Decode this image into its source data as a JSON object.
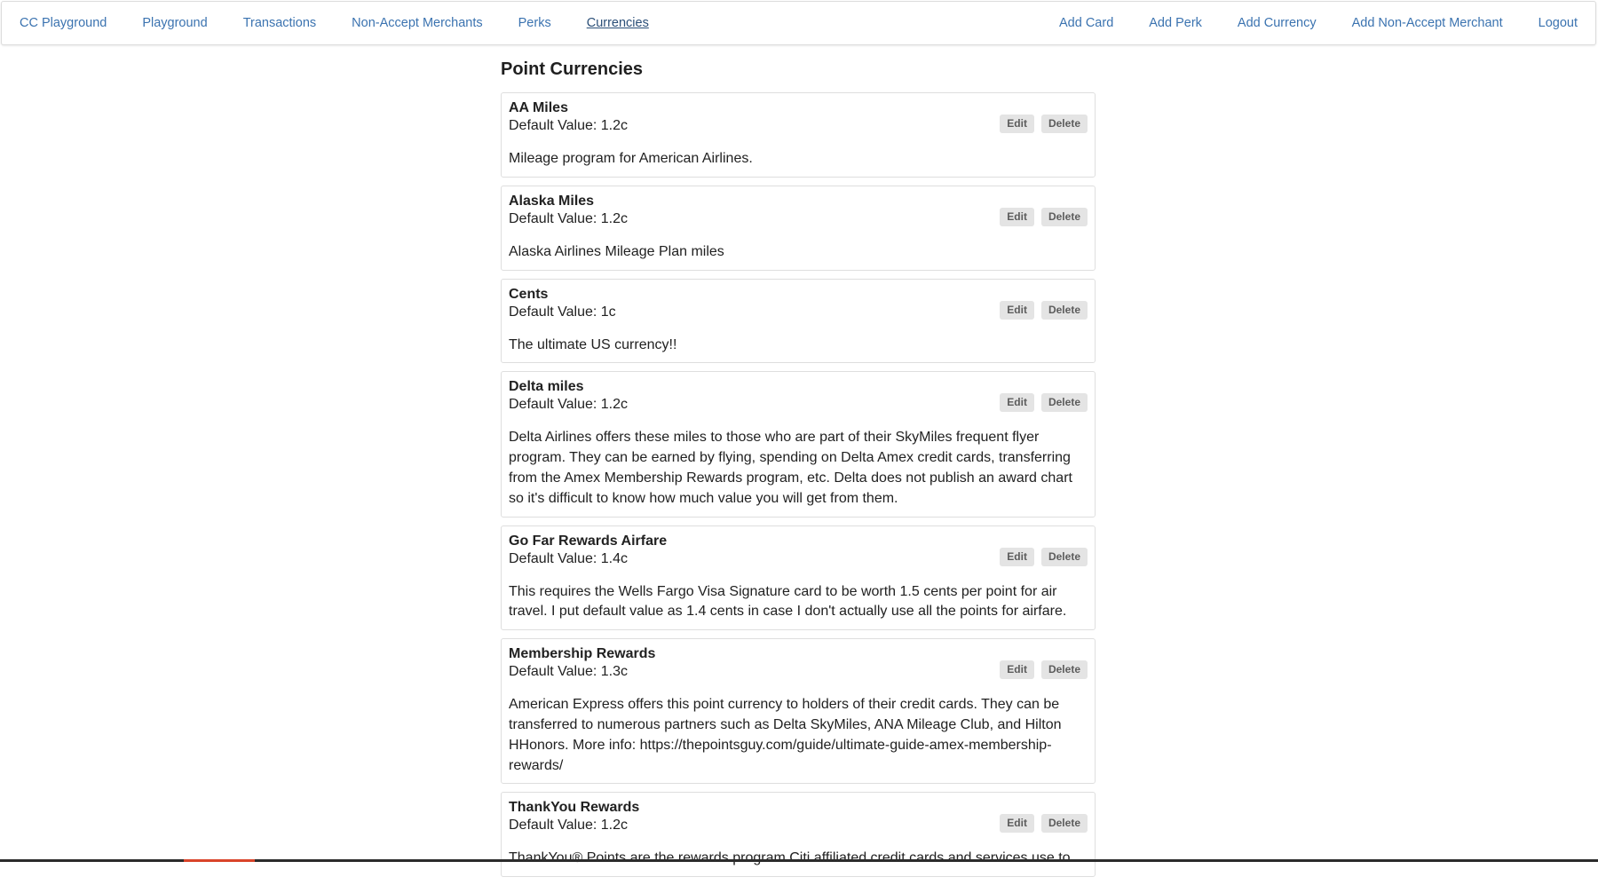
{
  "nav": {
    "left": [
      {
        "label": "CC Playground",
        "name": "nav-cc-playground",
        "active": false
      },
      {
        "label": "Playground",
        "name": "nav-playground",
        "active": false
      },
      {
        "label": "Transactions",
        "name": "nav-transactions",
        "active": false
      },
      {
        "label": "Non-Accept Merchants",
        "name": "nav-non-accept-merchants",
        "active": false
      },
      {
        "label": "Perks",
        "name": "nav-perks",
        "active": false
      },
      {
        "label": "Currencies",
        "name": "nav-currencies",
        "active": true
      }
    ],
    "right": [
      {
        "label": "Add Card",
        "name": "nav-add-card"
      },
      {
        "label": "Add Perk",
        "name": "nav-add-perk"
      },
      {
        "label": "Add Currency",
        "name": "nav-add-currency"
      },
      {
        "label": "Add Non-Accept Merchant",
        "name": "nav-add-non-accept-merchant"
      },
      {
        "label": "Logout",
        "name": "nav-logout"
      }
    ]
  },
  "page": {
    "title": "Point Currencies"
  },
  "buttons": {
    "edit": "Edit",
    "delete": "Delete"
  },
  "currencies": [
    {
      "name": "AA Miles",
      "default_value": "Default Value: 1.2c",
      "description": "Mileage program for American Airlines."
    },
    {
      "name": "Alaska Miles",
      "default_value": "Default Value: 1.2c",
      "description": "Alaska Airlines Mileage Plan miles"
    },
    {
      "name": "Cents",
      "default_value": "Default Value: 1c",
      "description": "The ultimate US currency!!"
    },
    {
      "name": "Delta miles",
      "default_value": "Default Value: 1.2c",
      "description": "Delta Airlines offers these miles to those who are part of their SkyMiles frequent flyer program. They can be earned by flying, spending on Delta Amex credit cards, transferring from the Amex Membership Rewards program, etc. Delta does not publish an award chart so it's difficult to know how much value you will get from them."
    },
    {
      "name": "Go Far Rewards Airfare",
      "default_value": "Default Value: 1.4c",
      "description": "This requires the Wells Fargo Visa Signature card to be worth 1.5 cents per point for air travel. I put default value as 1.4 cents in case I don't actually use all the points for airfare."
    },
    {
      "name": "Membership Rewards",
      "default_value": "Default Value: 1.3c",
      "description": "American Express offers this point currency to holders of their credit cards. They can be transferred to numerous partners such as Delta SkyMiles, ANA Mileage Club, and Hilton HHonors. More info: https://thepointsguy.com/guide/ultimate-guide-amex-membership-rewards/"
    },
    {
      "name": "ThankYou Rewards",
      "default_value": "Default Value: 1.2c",
      "description": "ThankYou® Points are the rewards program Citi affiliated credit cards and services use to"
    }
  ]
}
